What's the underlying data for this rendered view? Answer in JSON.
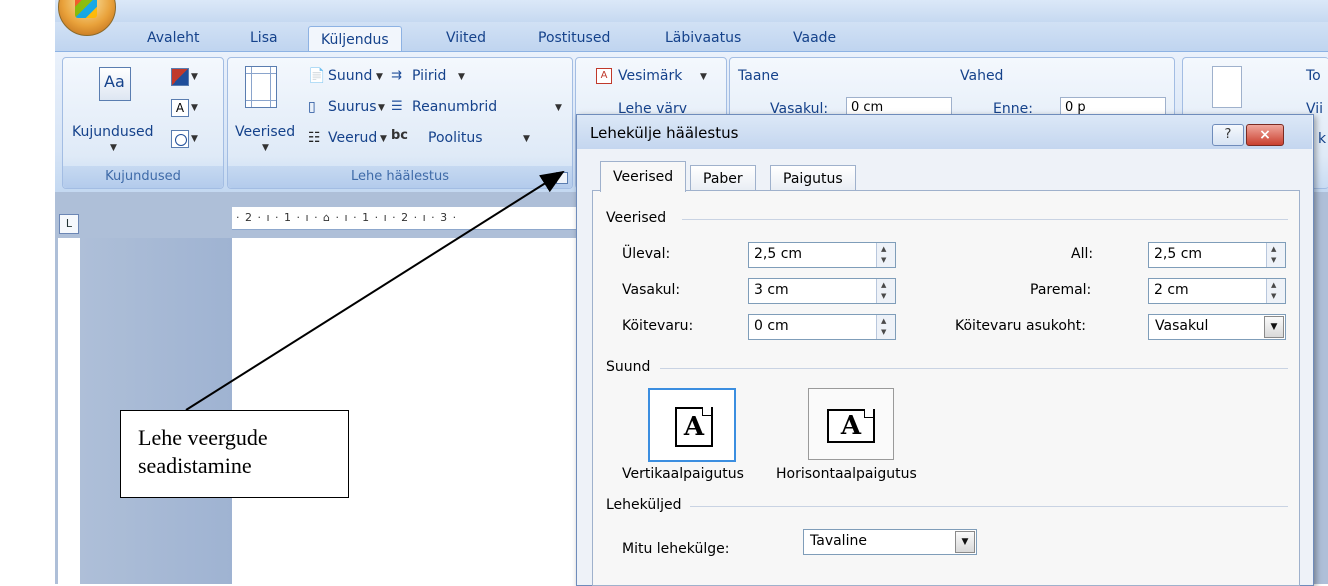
{
  "ribbon": {
    "tabs": [
      "Avaleht",
      "Lisa",
      "Küljendus",
      "Viited",
      "Postitused",
      "Läbivaatus",
      "Vaade"
    ],
    "active_tab": "Küljendus",
    "groups": {
      "kujundused": {
        "label": "Kujundused",
        "button": "Kujundused"
      },
      "lehe_haalestus": {
        "label": "Lehe häälestus",
        "veerised": "Veerised",
        "suund": "Suund",
        "suurus": "Suurus",
        "veerud": "Veerud",
        "piirid": "Piirid",
        "reanumbrid": "Reanumbrid",
        "poolitus": "Poolitus"
      },
      "page_background": {
        "vesimark": "Vesimärk",
        "lehe_varv": "Lehe värv"
      },
      "paragraph": {
        "taane": "Taane",
        "vasakul": "Vasakul:",
        "vasakul_value": "0 cm",
        "vahed": "Vahed",
        "enne": "Enne:",
        "enne_value": "0 p"
      },
      "arrange": {
        "item1": "To",
        "item2": "Vii",
        "item3": "k"
      }
    }
  },
  "ruler": {
    "ticks": "· 2 · ı · 1 · ı · ⌂ · ı · 1 · ı · 2 · ı · 3 ·"
  },
  "dialog": {
    "title": "Lehekülje häälestus",
    "help": "?",
    "close": "×",
    "tabs": [
      "Veerised",
      "Paber",
      "Paigutus"
    ],
    "active_tab": "Veerised",
    "margins": {
      "heading": "Veerised",
      "top_label": "Üleval:",
      "top_value": "2,5 cm",
      "bottom_label": "All:",
      "bottom_value": "2,5 cm",
      "left_label": "Vasakul:",
      "left_value": "3 cm",
      "right_label": "Paremal:",
      "right_value": "2 cm",
      "gutter_label": "Köitevaru:",
      "gutter_value": "0 cm",
      "gutter_pos_label": "Köitevaru asukoht:",
      "gutter_pos_value": "Vasakul"
    },
    "orientation": {
      "heading": "Suund",
      "portrait": "Vertikaalpaigutus",
      "landscape": "Horisontaalpaigutus",
      "glyph": "A"
    },
    "pages": {
      "heading": "Leheküljed",
      "multiple_label": "Mitu lehekülge:",
      "multiple_value": "Tavaline"
    }
  },
  "callout": {
    "line1": "Lehe veergude",
    "line2": "seadistamine"
  }
}
